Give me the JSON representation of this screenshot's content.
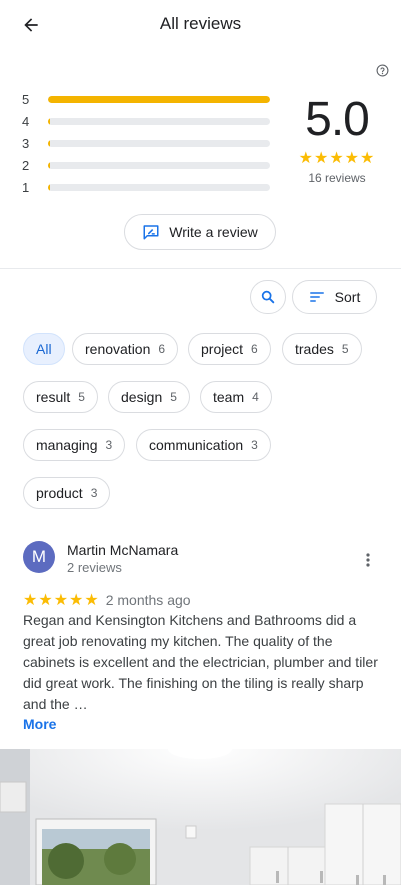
{
  "header": {
    "title": "All reviews"
  },
  "distribution": [
    {
      "label": "5",
      "fraction": 1.0
    },
    {
      "label": "4",
      "fraction": 0.01
    },
    {
      "label": "3",
      "fraction": 0.01
    },
    {
      "label": "2",
      "fraction": 0.01
    },
    {
      "label": "1",
      "fraction": 0.01
    }
  ],
  "summary": {
    "average": "5.0",
    "stars": "★★★★★",
    "count": "16 reviews"
  },
  "write_review": {
    "label": "Write a review"
  },
  "sort": {
    "label": "Sort"
  },
  "chips": [
    {
      "label": "All",
      "count": "",
      "selected": true
    },
    {
      "label": "renovation",
      "count": "6"
    },
    {
      "label": "project",
      "count": "6"
    },
    {
      "label": "trades",
      "count": "5"
    },
    {
      "label": "result",
      "count": "5"
    },
    {
      "label": "design",
      "count": "5"
    },
    {
      "label": "team",
      "count": "4"
    },
    {
      "label": "managing",
      "count": "3"
    },
    {
      "label": "communication",
      "count": "3"
    },
    {
      "label": "product",
      "count": "3"
    }
  ],
  "review": {
    "avatar_letter": "M",
    "author": "Martin McNamara",
    "author_sub": "2 reviews",
    "stars": "★★★★★",
    "time": "2 months ago",
    "text": "Regan and Kensington Kitchens and Bathrooms did a great job renovating my kitchen.  The quality of the cabinets is excellent and the electrician, plumber and tiler did great work.  The finishing on the tiling is really sharp and the …",
    "more_label": "More"
  },
  "colors": {
    "accent": "#1a73e8",
    "star": "#fbbc04",
    "bar": "#f4b400",
    "avatar": "#5c6bc0"
  }
}
